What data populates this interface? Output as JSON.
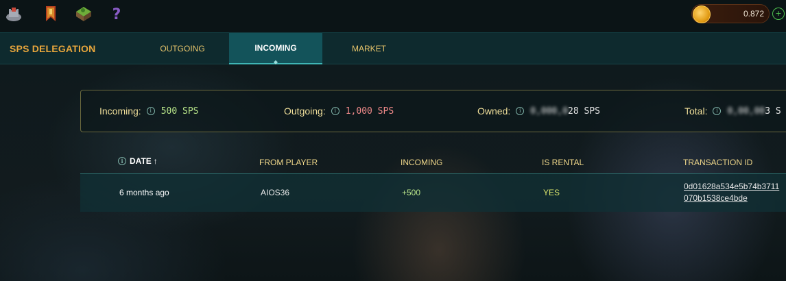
{
  "topbar": {
    "icons": [
      "castle-icon",
      "banner-icon",
      "land-icon",
      "help-icon"
    ],
    "wallet": {
      "value": "0.872",
      "currency_icon": "coin-icon"
    },
    "add_symbol": "+"
  },
  "nav": {
    "title": "SPS DELEGATION",
    "tabs": [
      {
        "label": "OUTGOING",
        "active": false
      },
      {
        "label": "INCOMING",
        "active": true
      },
      {
        "label": "MARKET",
        "active": false
      }
    ]
  },
  "summary": {
    "incoming": {
      "label": "Incoming:",
      "value": "500 SPS"
    },
    "outgoing": {
      "label": "Outgoing:",
      "value": "1,000 SPS"
    },
    "owned": {
      "label": "Owned:",
      "value_hidden": "0,000,0",
      "value_visible": "28 SPS"
    },
    "total": {
      "label": "Total:",
      "value_hidden": "0,00,00",
      "value_visible": "3 S"
    }
  },
  "table": {
    "columns": [
      "DATE",
      "FROM PLAYER",
      "INCOMING",
      "IS RENTAL",
      "TRANSACTION ID"
    ],
    "sort_arrow": "↑",
    "rows": [
      {
        "date": "6 months ago",
        "from_player": "AIOS36",
        "incoming": "+500",
        "is_rental": "YES",
        "transaction_id_line1": "0d01628a534e5b74b3711",
        "transaction_id_line2": "070b1538ce4bde"
      }
    ]
  },
  "colors": {
    "accent_gold": "#e8a63c",
    "label_yellow": "#f0df9a",
    "positive_green": "#b9e58a",
    "negative_red": "#f08a8a",
    "tab_active": "#13535a"
  }
}
